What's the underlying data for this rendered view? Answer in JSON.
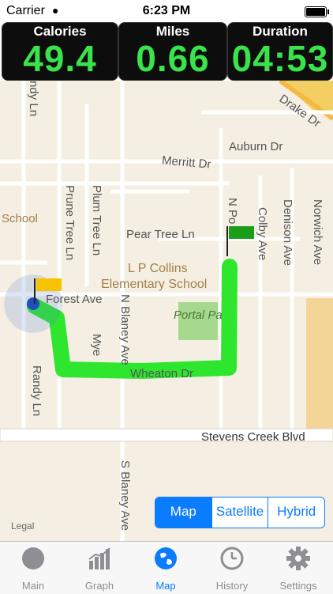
{
  "status_bar": {
    "carrier": "Carrier",
    "time": "6:23 PM"
  },
  "stats": [
    {
      "label": "Calories",
      "value": "49.4"
    },
    {
      "label": "Miles",
      "value": "0.66"
    },
    {
      "label": "Duration",
      "value": "04:53"
    }
  ],
  "map": {
    "streets": {
      "drake": "Drake Dr",
      "auburn": "Auburn Dr",
      "merritt": "Merritt Dr",
      "randy_top": "ndy Ln",
      "prune": "Prune Tree Ln",
      "plum": "Plum Tree Ln",
      "n_po": "N Po",
      "colby": "Colby Ave",
      "denison": "Denison Ave",
      "norwich": "Norwich Ave",
      "pear": "Pear Tree Ln",
      "school_left": "School",
      "collins1": "L P Collins",
      "collins2": "Elementary School",
      "forest": "Forest Ave",
      "portal": "Portal Pa",
      "myers": "Mye",
      "n_blaney": "N Blaney Ave",
      "wheaton": "Wheaton Dr",
      "randy": "Randy Ln",
      "stevens": "Stevens Creek Blvd",
      "s_blaney": "S Blaney Ave",
      "legal": "Legal"
    },
    "map_types": [
      "Map",
      "Satellite",
      "Hybrid"
    ],
    "selected_map_type": "Map",
    "route_color": "#2ee62e"
  },
  "tabs": [
    {
      "label": "Main",
      "icon": "circle-icon"
    },
    {
      "label": "Graph",
      "icon": "graph-icon"
    },
    {
      "label": "Map",
      "icon": "globe-icon",
      "active": true
    },
    {
      "label": "History",
      "icon": "clock-icon"
    },
    {
      "label": "Settings",
      "icon": "gear-icon"
    }
  ]
}
